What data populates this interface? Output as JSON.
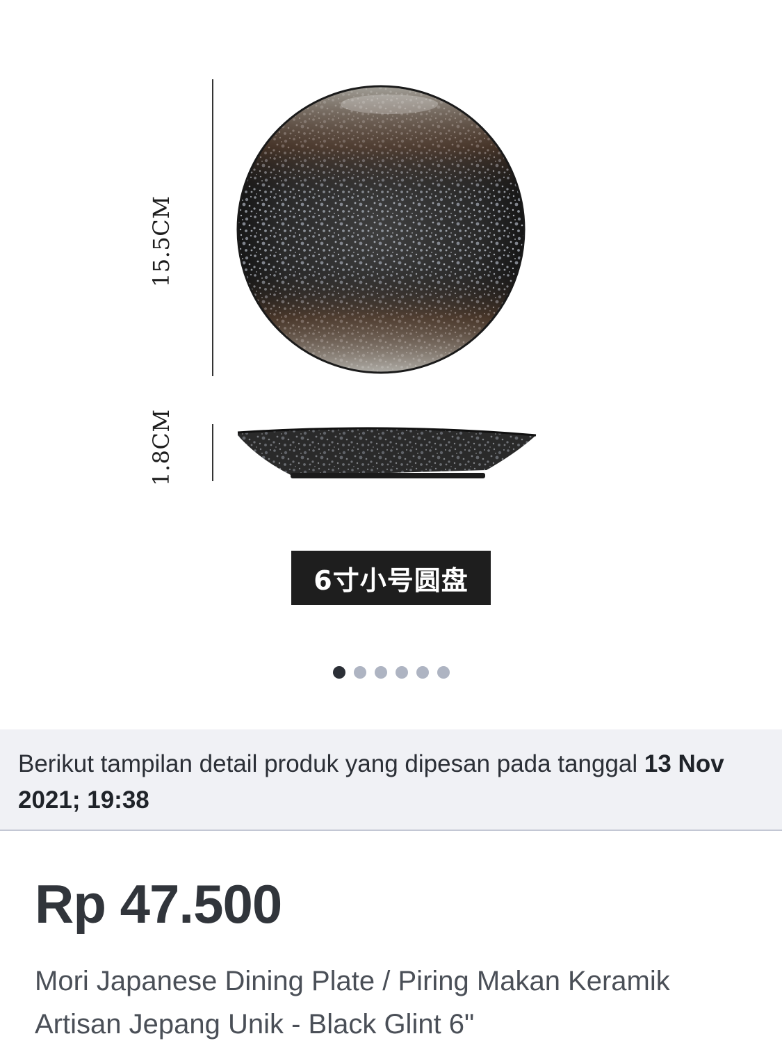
{
  "product_image": {
    "height_label": "15.5CM",
    "depth_label": "1.8CM",
    "caption": "6寸小号圆盘"
  },
  "carousel": {
    "total_dots": 6,
    "active_index": 0
  },
  "order_info": {
    "text": "Berikut tampilan detail produk yang dipesan pada tanggal ",
    "date": "13 Nov 2021; 19:38"
  },
  "product": {
    "price": "Rp 47.500",
    "title": "Mori Japanese Dining Plate / Piring Makan Keramik Artisan Jepang Unik - Black Glint 6\""
  },
  "colors": {
    "banner_bg": "#f0f1f5",
    "price_text": "#31353b",
    "dot_active": "#2b2f36",
    "dot_inactive": "#aeb4c2"
  }
}
